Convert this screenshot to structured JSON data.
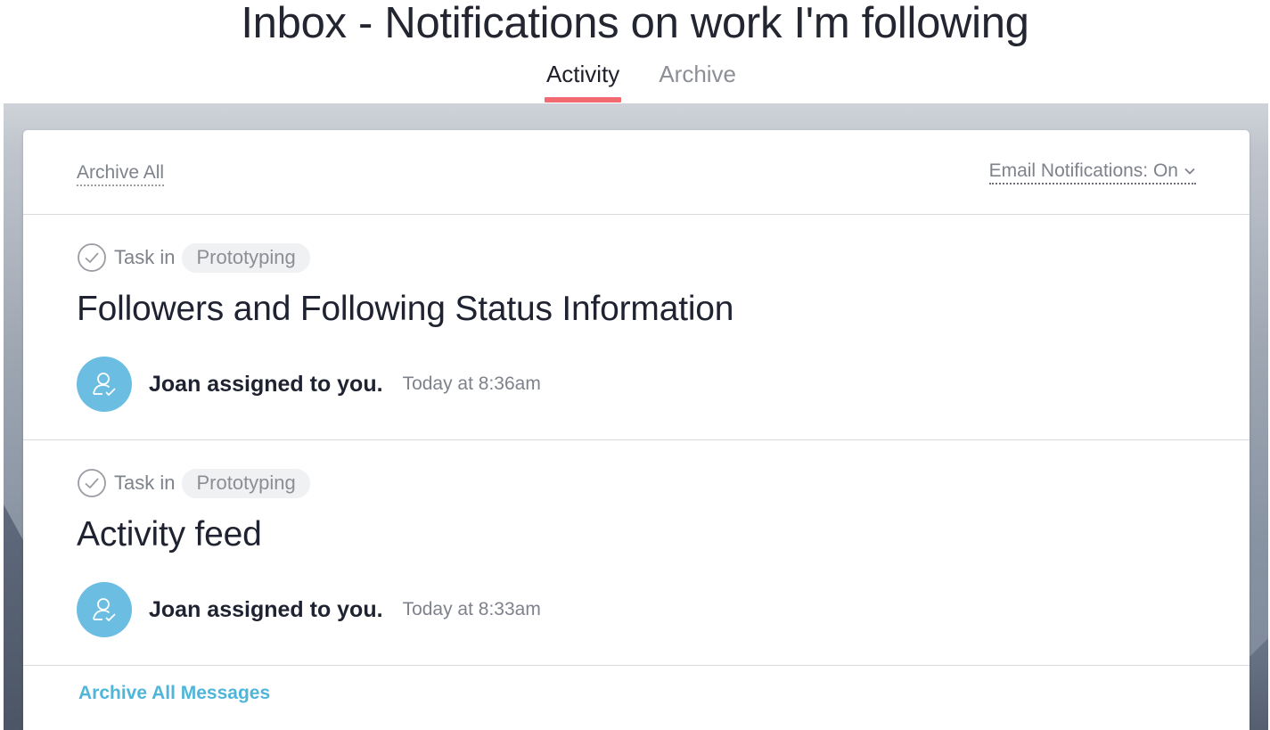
{
  "page": {
    "title": "Inbox - Notifications on work I'm following"
  },
  "tabs": [
    {
      "label": "Activity",
      "active": true
    },
    {
      "label": "Archive",
      "active": false
    }
  ],
  "colors": {
    "active_tab_underline": "#f16a70",
    "avatar_bg": "#6bbde2",
    "link": "#4fb6d9"
  },
  "toolbar": {
    "archive_all_label": "Archive All",
    "email_notifications_label": "Email Notifications: On",
    "email_notifications_icon": "chevron-down-icon"
  },
  "items": [
    {
      "type_icon": "check-circle-icon",
      "prefix": "Task in",
      "project": "Prototyping",
      "title": "Followers and Following Status Information",
      "avatar_icon": "user-check-icon",
      "activity": "Joan assigned to you.",
      "timestamp": "Today at 8:36am"
    },
    {
      "type_icon": "check-circle-icon",
      "prefix": "Task in",
      "project": "Prototyping",
      "title": "Activity feed",
      "avatar_icon": "user-check-icon",
      "activity": "Joan assigned to you.",
      "timestamp": "Today at 8:33am"
    }
  ],
  "footer": {
    "archive_all_messages_label": "Archive All Messages"
  }
}
